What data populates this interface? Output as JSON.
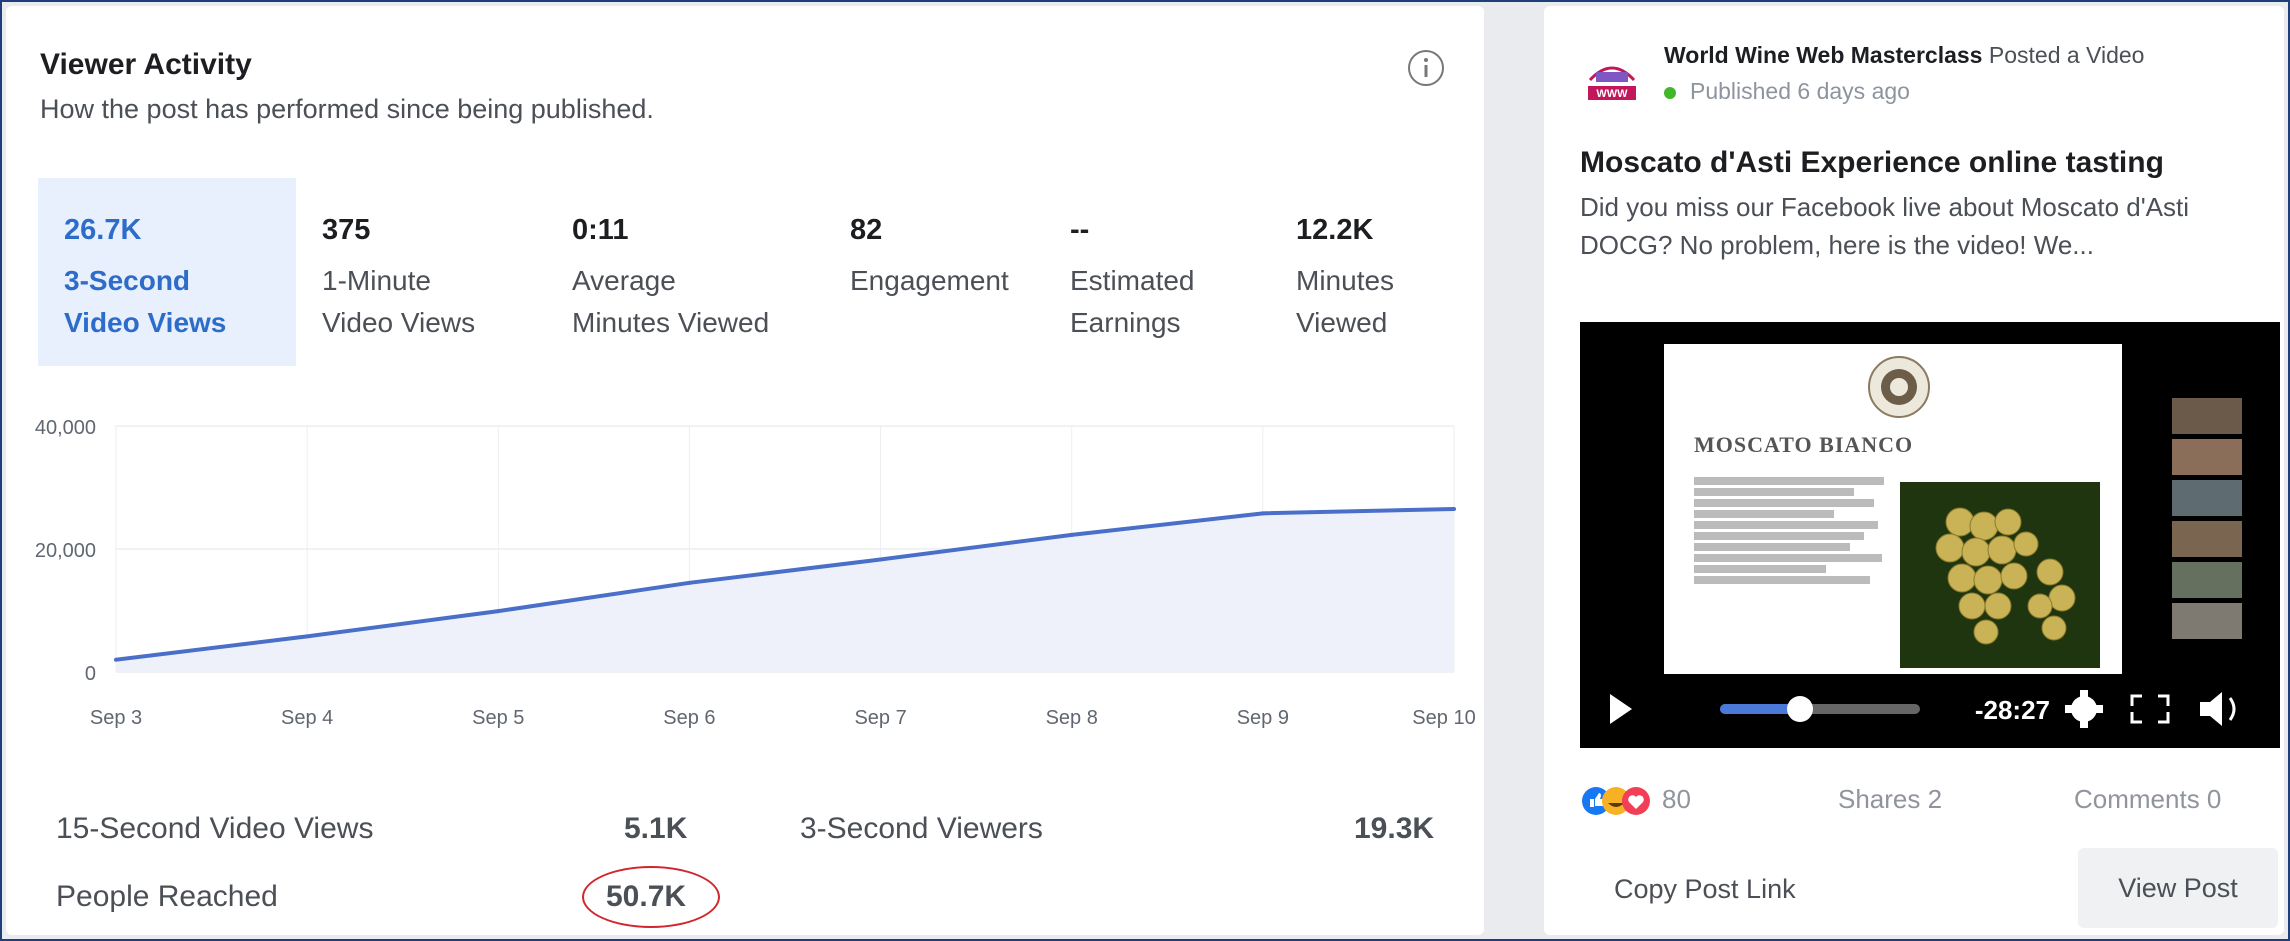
{
  "header": {
    "title": "Viewer Activity",
    "subtitle": "How the post has performed since being published."
  },
  "tabs": [
    {
      "value": "26.7K",
      "label": "3-Second\nVideo Views",
      "selected": true
    },
    {
      "value": "375",
      "label": "1-Minute\nVideo Views",
      "selected": false
    },
    {
      "value": "0:11",
      "label": "Average\nMinutes Viewed",
      "selected": false
    },
    {
      "value": "82",
      "label": "Engagement",
      "selected": false
    },
    {
      "value": "--",
      "label": "Estimated\nEarnings",
      "selected": false
    },
    {
      "value": "12.2K",
      "label": "Minutes\nViewed",
      "selected": false
    }
  ],
  "chart_data": {
    "type": "area",
    "x": [
      "Sep 3",
      "Sep 4",
      "Sep 5",
      "Sep 6",
      "Sep 7",
      "Sep 8",
      "Sep 9",
      "Sep 10"
    ],
    "series": [
      {
        "values": [
          2000,
          5800,
          9900,
          14500,
          18300,
          22300,
          25800,
          26500
        ]
      }
    ],
    "ylim": [
      0,
      40000
    ],
    "yticks": [
      "40,000",
      "20,000",
      "0"
    ],
    "grid": true,
    "line_color": "#4a6fc9",
    "fill_color": "#eef1fa"
  },
  "metrics": {
    "fifteen_label": "15-Second Video Views",
    "fifteen_value": "5.1K",
    "three_viewers_label": "3-Second Viewers",
    "three_viewers_value": "19.3K",
    "reached_label": "People Reached",
    "reached_value": "50.7K"
  },
  "post": {
    "page_name": "World Wine Web Masterclass",
    "action": "Posted a Video",
    "published": "Published 6 days ago",
    "title": "Moscato d'Asti Experience online tasting",
    "description": "Did you miss our Facebook live about Moscato d'Asti DOCG? No problem, here is the video! We...",
    "video": {
      "slide_heading": "MOSCATO BIANCO",
      "time_remaining": "-28:27",
      "progress": 0.4
    },
    "reaction_count": "80",
    "shares": "Shares 2",
    "comments": "Comments 0",
    "copy_link": "Copy Post Link",
    "view_post": "View Post"
  },
  "colors": {
    "accent": "#2d6cc9",
    "selected_tab_bg": "#e7f0fc",
    "highlight": "#d0262e",
    "online": "#42b72a"
  }
}
